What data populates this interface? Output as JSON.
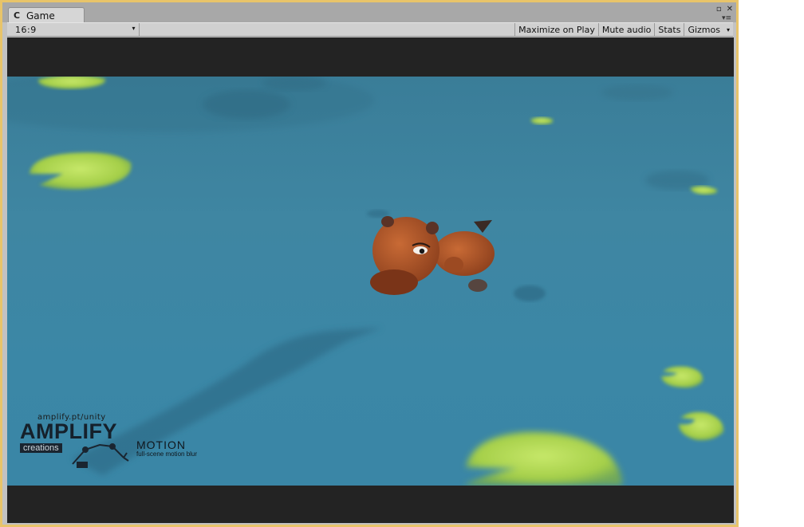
{
  "window": {
    "tab_label": "Game",
    "tab_icon": "unity-game-icon",
    "controls": {
      "restore_glyph": "▫",
      "close_glyph": "✕",
      "menu_glyph": "▾≡"
    }
  },
  "toolbar": {
    "aspect_ratio": "16:9",
    "aspect_arrow": "▾",
    "maximize_on_play": "Maximize on Play",
    "mute_audio": "Mute audio",
    "stats": "Stats",
    "gizmos": "Gizmos",
    "gizmos_arrow": "▾"
  },
  "overlay": {
    "url": "amplify.pt/unity",
    "brand": "AMPLIFY",
    "brand_sub": "creations",
    "product": "MOTION",
    "tagline": "full-scene motion blur"
  },
  "colors": {
    "window_border": "#e8c46a",
    "water": "#3b85a4",
    "lilypad": "#a9d14a",
    "capybara": "#b0562a",
    "letterbox": "#232323"
  }
}
